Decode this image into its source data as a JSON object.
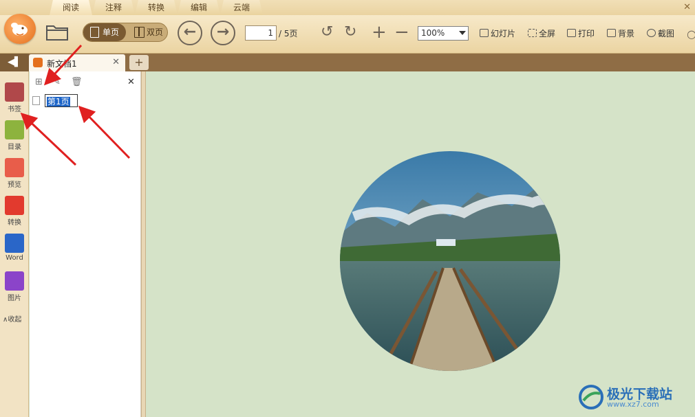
{
  "menu_tabs": [
    "阅读",
    "注释",
    "转换",
    "编辑",
    "云端"
  ],
  "toolbar": {
    "single_page": "单页",
    "double_page": "双页",
    "page_current": "1",
    "page_total": "/ 5页",
    "zoom": "100%",
    "slideshow": "幻灯片",
    "fullscreen": "全屏",
    "print": "打印",
    "background": "背景",
    "screenshot": "截图"
  },
  "doc_tab": {
    "title": "新文档1"
  },
  "sidebar": {
    "items": [
      {
        "label": "书签",
        "icon": "bookmark-icon",
        "color": "#b0484a"
      },
      {
        "label": "目录",
        "icon": "toc-icon",
        "color": "#8db33e"
      },
      {
        "label": "预览",
        "icon": "preview-icon",
        "color": "#e85d4a"
      },
      {
        "label": "转换",
        "icon": "pdf-to-word-icon",
        "color": "#e23a2e"
      },
      {
        "label": "Word",
        "icon": "word-icon",
        "color": "#2a66c8"
      },
      {
        "label": "图片",
        "icon": "image-icon",
        "color": "#8b44c9"
      }
    ],
    "collapse": "∧收起"
  },
  "bookmark_panel": {
    "bookmark_label": "第1页"
  },
  "watermark": {
    "title": "极光下载站",
    "url": "www.xz7.com"
  },
  "colors": {
    "accent": "#7a5a32",
    "canvas": "#d5e3c8",
    "annotation_arrow": "#e02020"
  }
}
